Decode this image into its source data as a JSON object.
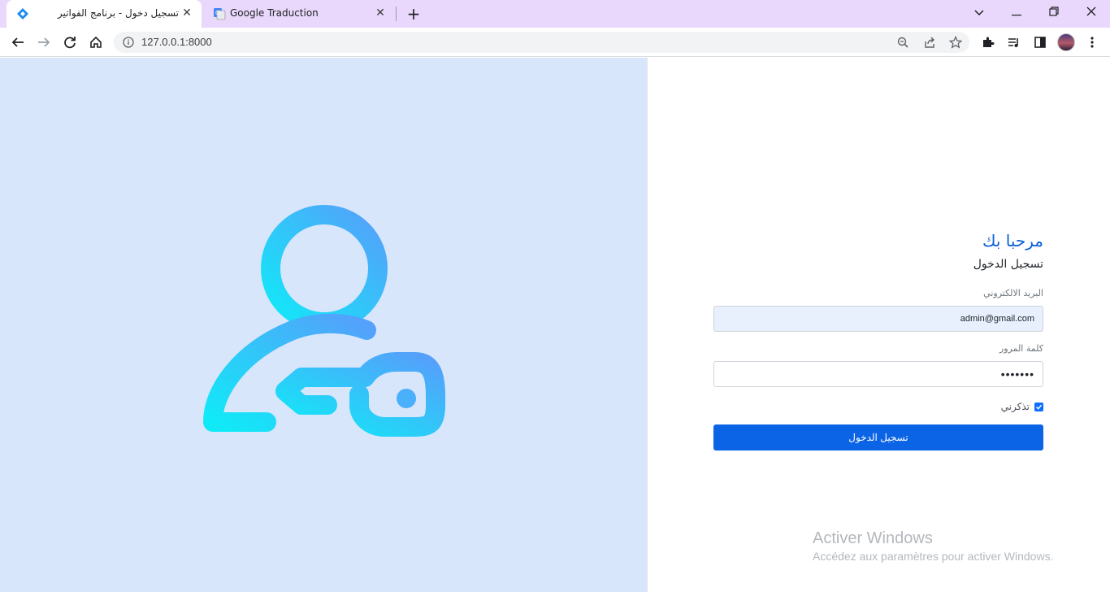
{
  "browser": {
    "tabs": [
      {
        "title": "تسجيل دخول - برنامج الفواتير",
        "active": true,
        "icon": "diamond-favicon"
      },
      {
        "title": "Google Traduction",
        "active": false,
        "icon": "google-translate-favicon"
      }
    ],
    "url": "127.0.0.1:8000",
    "theme_color": "#e9d8fb"
  },
  "hero": {
    "icon": "user-key-icon",
    "gradient_start": "#10eaf7",
    "gradient_end": "#52a6fb",
    "background": "#d8e6fc"
  },
  "login": {
    "welcome": "مرحبا بك",
    "subtitle": "تسجيل الدخول",
    "email_label": "البريد الالكتروني",
    "email_value": "admin@gmail.com",
    "password_label": "كلمة المرور",
    "password_value": "•••••••",
    "remember_label": "تذكرني",
    "remember_checked": true,
    "submit_label": "تسجيل الدخول",
    "accent_color": "#0b63e5"
  },
  "watermark": {
    "title": "Activer Windows",
    "subtitle": "Accédez aux paramètres pour activer Windows."
  }
}
